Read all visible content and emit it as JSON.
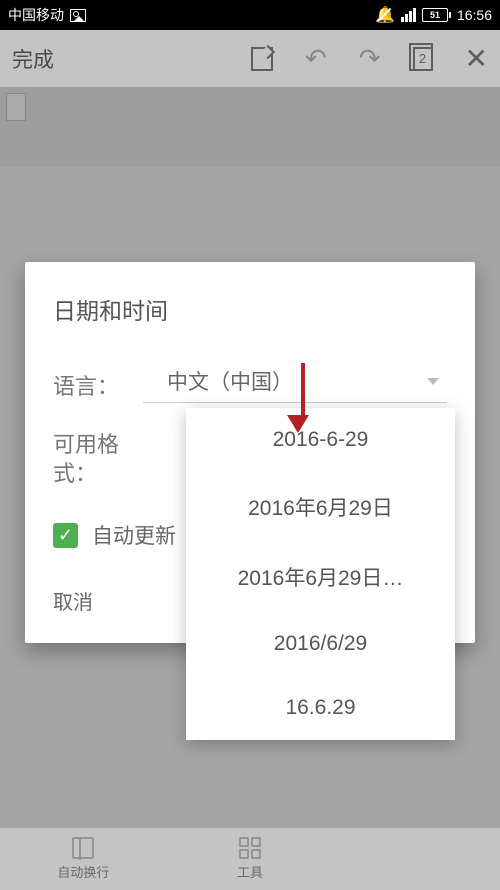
{
  "statusBar": {
    "carrier": "中国移动",
    "battery": "51",
    "time": "16:56"
  },
  "topbar": {
    "done": "完成",
    "pageCount": "2"
  },
  "dialog": {
    "title": "日期和时间",
    "languageLabel": "语言：",
    "languageValue": "中文（中国）",
    "formatLabel": "可用格式：",
    "autoUpdateLabel": "自动更新",
    "cancel": "取消"
  },
  "dropdownMenu": {
    "items": [
      "2016-6-29",
      "2016年6月29日",
      "2016年6月29日…",
      "2016/6/29",
      "16.6.29"
    ]
  },
  "bottomBar": {
    "wrap": "自动换行",
    "tools": "工具"
  }
}
